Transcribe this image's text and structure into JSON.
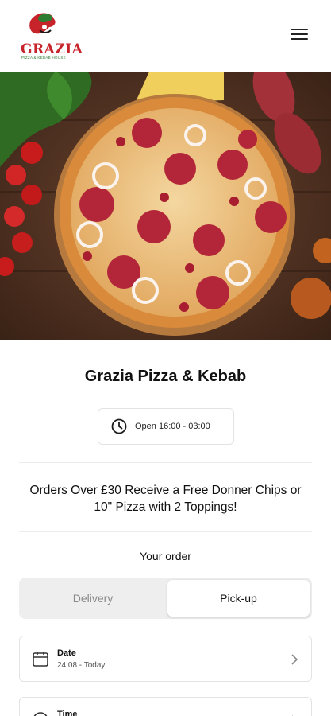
{
  "header": {
    "logo_text": "GRAZIA",
    "logo_subtext": "PIZZA & KEBAB HOUSE",
    "menu_icon": "hamburger-menu-icon"
  },
  "restaurant": {
    "name": "Grazia Pizza & Kebab",
    "hours": "Open 16:00 - 03:00",
    "hours_icon": "clock-icon"
  },
  "promo": {
    "text": "Orders Over £30 Receive a Free Donner Chips or 10\" Pizza with 2 Toppings!"
  },
  "order": {
    "title": "Your order",
    "modes": {
      "delivery": "Delivery",
      "pickup": "Pick-up",
      "selected": "pickup"
    },
    "date": {
      "label": "Date",
      "value": "24.08 - Today",
      "icon": "calendar-icon"
    },
    "time": {
      "label": "Time",
      "icon": "clock-icon"
    }
  },
  "colors": {
    "brand_red": "#c7232b",
    "brand_green": "#2e7d32"
  }
}
